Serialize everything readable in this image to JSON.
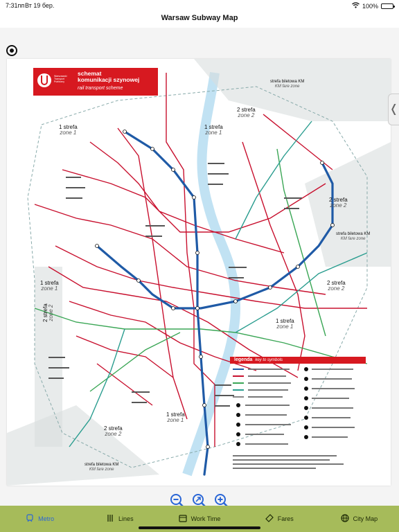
{
  "status": {
    "time": "7:31пп",
    "date": "Вт 19 бер.",
    "battery": "100%"
  },
  "nav": {
    "title": "Warsaw Subway Map"
  },
  "map": {
    "header_title": "schemat komunikacji szynowej",
    "header_line1": "schemat",
    "header_line2": "komunikacji szynowej",
    "header_subtitle": "rail transport scheme",
    "logo_text": [
      "Warszawski",
      "Transport",
      "Publiczny"
    ],
    "zones": [
      {
        "pl": "1 strefa",
        "en": "zone 1"
      },
      {
        "pl": "2 strefa",
        "en": "zone 2"
      }
    ],
    "km_area_pl": "strefa biletowa KM",
    "km_area_en": "KM fare zone",
    "legend_title": "legenda",
    "legend_subtitle": "key to symbols",
    "colors": {
      "brand_red": "#d71920",
      "metro_blue": "#1f5aa6",
      "tram_red": "#c8102e",
      "skm_green": "#3aa655",
      "km_teal": "#2a9d8f",
      "river": "#a7d6ee"
    }
  },
  "zoom": {
    "out_icon": "zoom-out-icon",
    "reset_icon": "zoom-reset-icon",
    "in_icon": "zoom-in-icon"
  },
  "tabs": [
    {
      "label": "Metro",
      "icon": "metro-icon",
      "active": true
    },
    {
      "label": "Lines",
      "icon": "lines-icon",
      "active": false
    },
    {
      "label": "Work Time",
      "icon": "calendar-icon",
      "active": false
    },
    {
      "label": "Fares",
      "icon": "ticket-icon",
      "active": false
    },
    {
      "label": "City Map",
      "icon": "globe-icon",
      "active": false
    }
  ]
}
